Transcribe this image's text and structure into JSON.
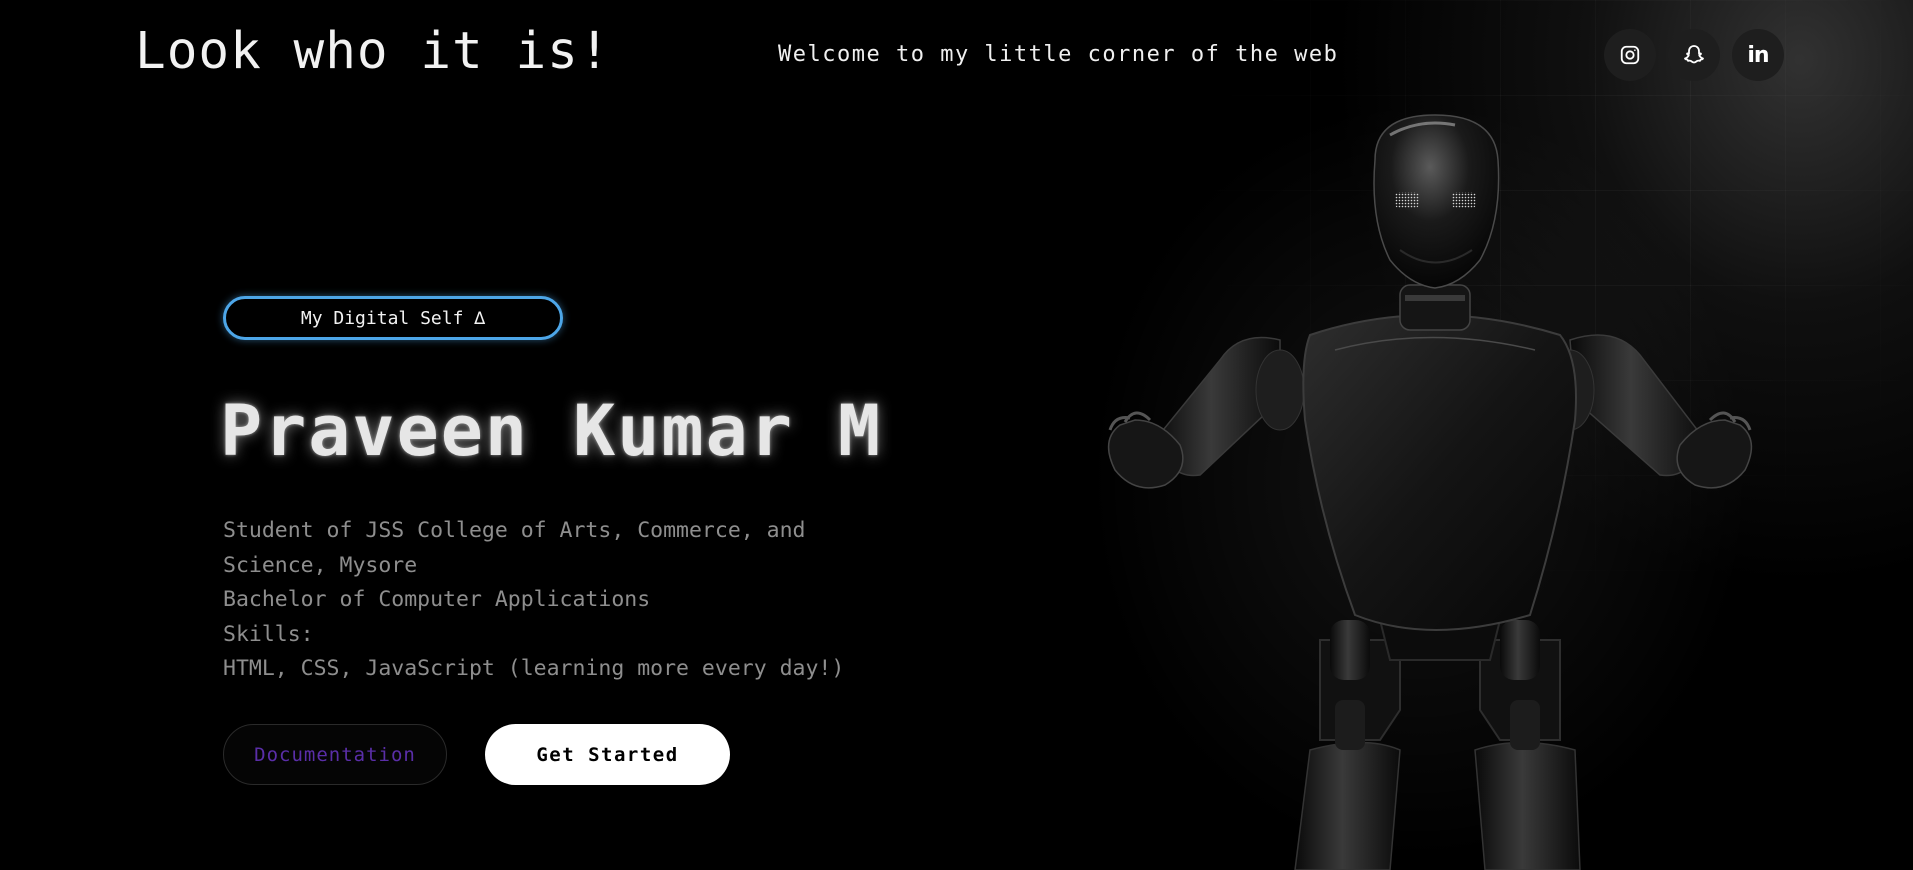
{
  "header": {
    "brand": "Look who it is!",
    "tagline": "Welcome to my little corner of the web",
    "socials": [
      {
        "icon": "instagram-icon"
      },
      {
        "icon": "snapchat-icon"
      },
      {
        "icon": "linkedin-icon",
        "label": "in"
      }
    ]
  },
  "hero": {
    "badge": "My Digital Self ∆",
    "name": "Praveen Kumar M",
    "bio": {
      "line1": "Student of JSS College of Arts, Commerce, and",
      "line2": "Science, Mysore",
      "line3": "Bachelor of Computer Applications",
      "line4": "Skills:",
      "line5": "HTML, CSS, JavaScript (learning more every day!)"
    },
    "buttons": {
      "docs": "Documentation",
      "start": "Get Started"
    }
  },
  "colors": {
    "background": "#000000",
    "badge_border": "#4da6e8",
    "docs_text": "#5a2ea8",
    "bio_text": "#8e8e8e"
  }
}
